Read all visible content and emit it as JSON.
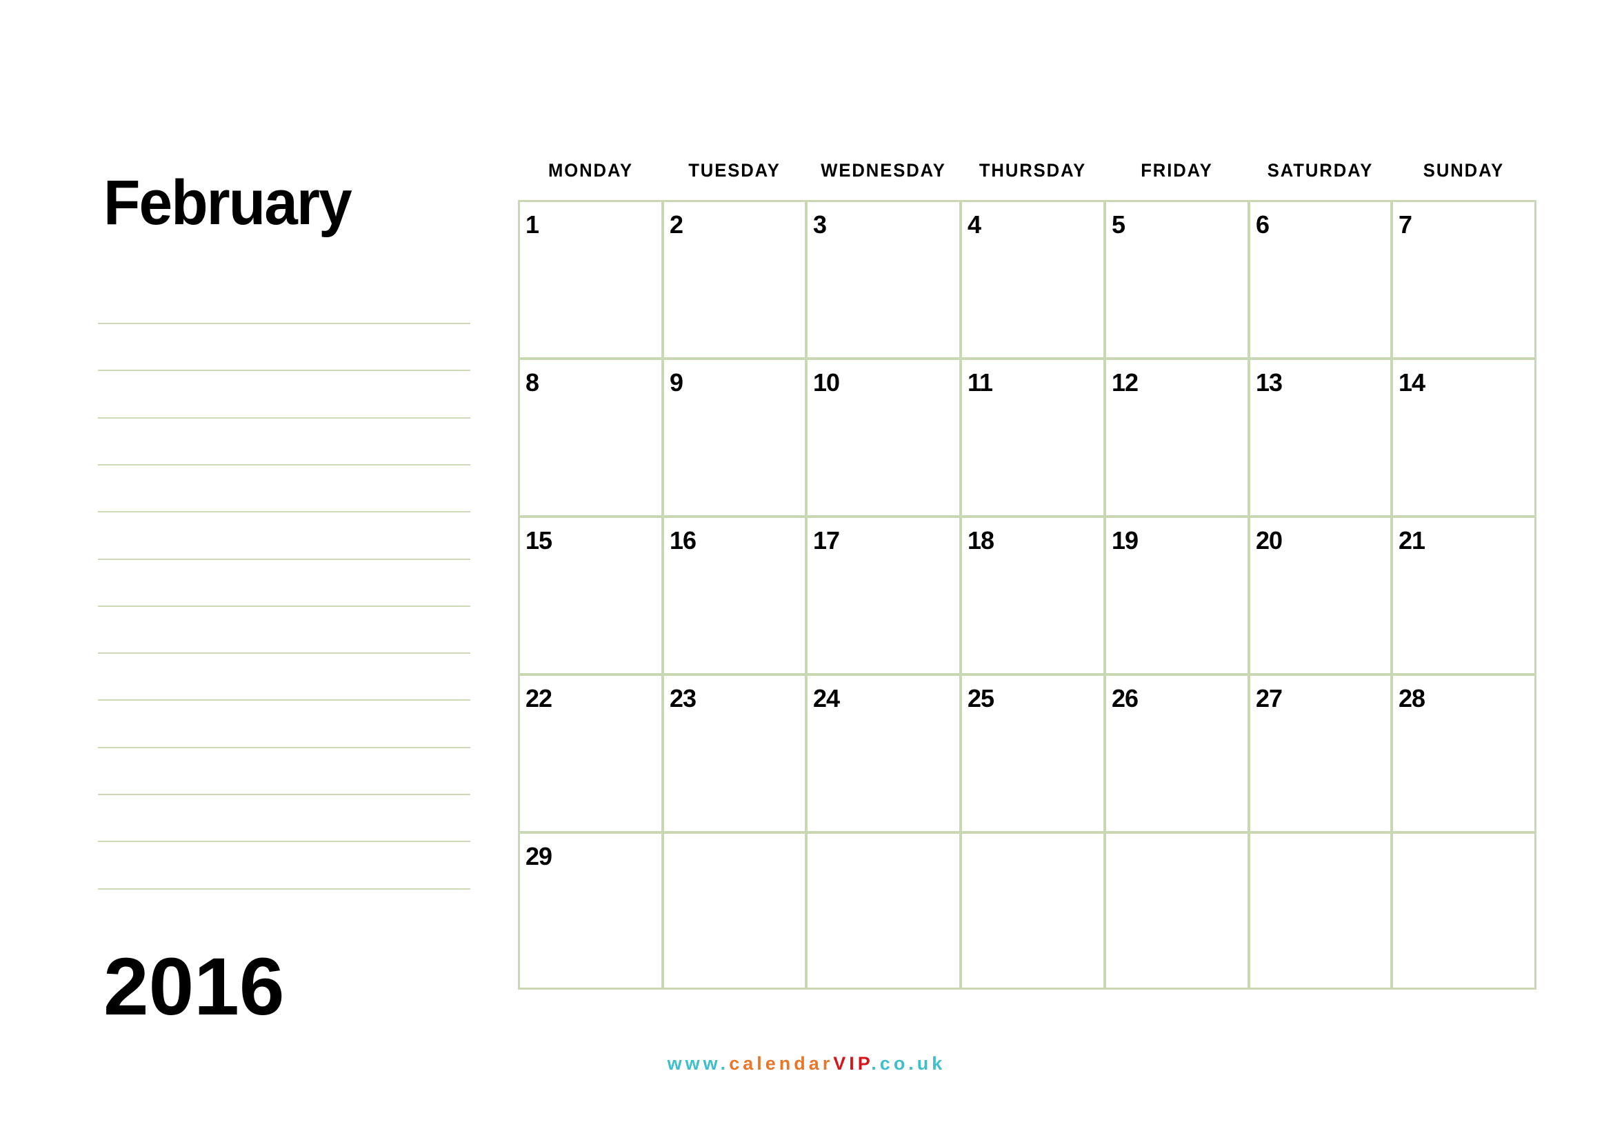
{
  "month": "February",
  "year": "2016",
  "weekdays": [
    "MONDAY",
    "TUESDAY",
    "WEDNESDAY",
    "THURSDAY",
    "FRIDAY",
    "SATURDAY",
    "SUNDAY"
  ],
  "weeks": [
    [
      "1",
      "2",
      "3",
      "4",
      "5",
      "6",
      "7"
    ],
    [
      "8",
      "9",
      "10",
      "11",
      "12",
      "13",
      "14"
    ],
    [
      "15",
      "16",
      "17",
      "18",
      "19",
      "20",
      "21"
    ],
    [
      "22",
      "23",
      "24",
      "25",
      "26",
      "27",
      "28"
    ],
    [
      "29",
      "",
      "",
      "",
      "",
      "",
      ""
    ]
  ],
  "notes_line_count": 13,
  "footer": {
    "part1": "www.",
    "part2": "calendar",
    "part3": "VIP",
    "part4": ".co.uk"
  },
  "colors": {
    "grid_line": "#c9d7b2",
    "footer_teal": "#3fbfcb",
    "footer_orange": "#e8772a",
    "footer_red": "#d4161c"
  }
}
